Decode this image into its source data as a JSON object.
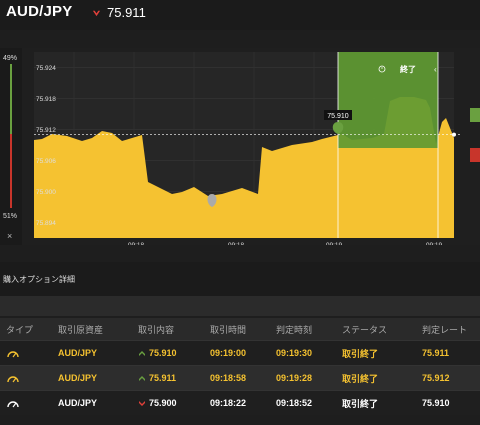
{
  "header": {
    "symbol": "AUD/JPY",
    "price": "75.911",
    "direction_icon": "down-arrow-icon",
    "direction_color": "#e0403a"
  },
  "side_ratio": {
    "up_pct": "49%",
    "down_pct": "51%",
    "close_label": "×",
    "up_color": "#6aa040",
    "down_color": "#c8352b"
  },
  "chart_data": {
    "type": "area",
    "y_ticks": [
      "75.924",
      "75.918",
      "75.912",
      "75.906",
      "75.900",
      "75.894"
    ],
    "x_ticks": [
      "09:18",
      "09:18",
      "09:19",
      "09:19"
    ],
    "ylim": [
      75.891,
      75.927
    ],
    "current_price": 75.911,
    "area_color": "#f5c231",
    "entry_marker_label": "75.910",
    "expiry_label": "終了",
    "expiry_zone_color": "#5f9a32",
    "grid": true
  },
  "section": {
    "title": "購入オプション詳細"
  },
  "table": {
    "headers": [
      "タイプ",
      "取引原資産",
      "取引内容",
      "取引時間",
      "判定時刻",
      "ステータス",
      "判定レート"
    ],
    "rows": [
      {
        "asset": "AUD/JPY",
        "content": "75.910",
        "direction": "up",
        "time": "09:19:00",
        "judge": "09:19:30",
        "status": "取引終了",
        "rate": "75.911"
      },
      {
        "asset": "AUD/JPY",
        "content": "75.911",
        "direction": "up",
        "time": "09:18:58",
        "judge": "09:19:28",
        "status": "取引終了",
        "rate": "75.912"
      },
      {
        "asset": "AUD/JPY",
        "content": "75.900",
        "direction": "down",
        "time": "09:18:22",
        "judge": "09:18:52",
        "status": "取引終了",
        "rate": "75.910"
      }
    ]
  }
}
